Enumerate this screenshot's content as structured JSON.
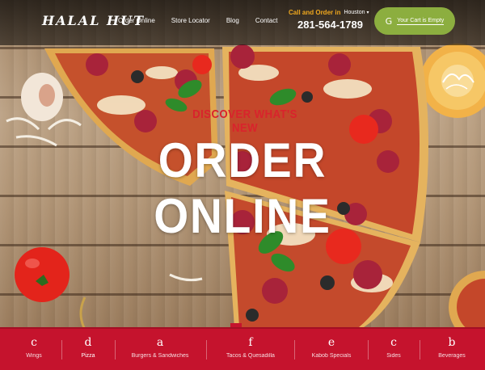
{
  "header": {
    "logo": "HALAL HUT",
    "nav": [
      "Order Online",
      "Store Locator",
      "Blog",
      "Contact"
    ],
    "call_label": "Call and Order in",
    "city": "Houston",
    "phone": "281-564-1789",
    "cart_icon": "G",
    "cart_label": "Your Cart is Empty"
  },
  "hero": {
    "kicker": "DISCOVER WHAT'S NEW",
    "title": "ORDER ONLINE"
  },
  "categories": [
    {
      "icon": "c",
      "label": "Wings"
    },
    {
      "icon": "d",
      "label": "Pizza"
    },
    {
      "icon": "a",
      "label": "Burgers & Sandwiches"
    },
    {
      "icon": "f",
      "label": "Tacos & Quesadilla"
    },
    {
      "icon": "e",
      "label": "Kabob Specials"
    },
    {
      "icon": "c",
      "label": "Sides"
    },
    {
      "icon": "b",
      "label": "Beverages"
    }
  ],
  "active_category": "Pizza",
  "colors": {
    "brand_red": "#c5132d",
    "accent_orange": "#f0a81e",
    "cart_green": "#8cae3f"
  }
}
